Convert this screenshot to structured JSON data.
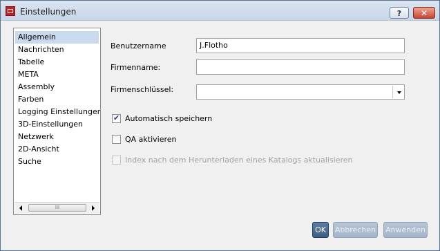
{
  "window": {
    "title": "Einstellungen",
    "help_label": "?",
    "close_label": "✕"
  },
  "sidebar": {
    "items": [
      {
        "label": "Allgemein",
        "selected": true
      },
      {
        "label": "Nachrichten"
      },
      {
        "label": "Tabelle"
      },
      {
        "label": "META"
      },
      {
        "label": "Assembly"
      },
      {
        "label": "Farben"
      },
      {
        "label": "Logging Einstellungen"
      },
      {
        "label": "3D-Einstellungen"
      },
      {
        "label": "Netzwerk"
      },
      {
        "label": "2D-Ansicht"
      },
      {
        "label": "Suche"
      }
    ],
    "scrollbar_thumb_grip": "III"
  },
  "form": {
    "benutzername_label": "Benutzername",
    "benutzername_value": "J.Flotho",
    "firmenname_label": "Firmenname:",
    "firmenname_value": "",
    "firmenschluessel_label": "Firmenschlüssel:",
    "firmenschluessel_value": ""
  },
  "options": {
    "auto_save_label": "Automatisch speichern",
    "auto_save_checked": true,
    "qa_label": "QA aktivieren",
    "qa_checked": false,
    "index_label": "Index nach dem Herunterladen eines Katalogs aktualisieren",
    "index_checked": false,
    "index_disabled": true
  },
  "buttons": {
    "ok": "OK",
    "abbrechen": "Abbrechen",
    "anwenden": "Anwenden"
  },
  "colors": {
    "selection": "#c9daef",
    "close": "#c8462f",
    "ok": "#3e5d82"
  }
}
